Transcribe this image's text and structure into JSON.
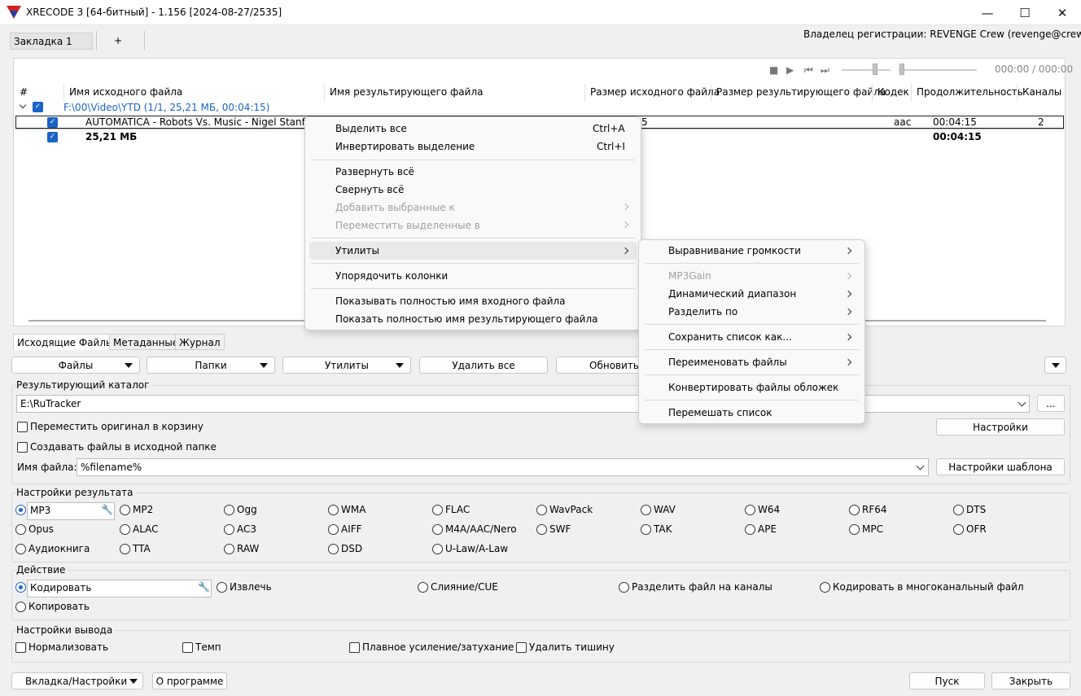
{
  "window": {
    "title": "XRECODE 3 [64-битный] - 1.156 [2024-08-27/2535]",
    "minimize": "—",
    "maximize": "☐",
    "close": "✕"
  },
  "tabs": {
    "active": "Закладка 1",
    "add": "+"
  },
  "owner": "Владелец регистрации: REVENGE Crew (revenge@crew.com)",
  "player": {
    "time": "000:00 / 000:00"
  },
  "columns": [
    "#",
    "Имя исходного файла",
    "Имя результирующего файла",
    "Размер исходного файла",
    "Размер результирующего файла",
    "Кодек",
    "Продолжительность",
    "Каналы"
  ],
  "list": {
    "group": "F:\\00\\Video\\YTD (1/1, 25,21 МБ, 00:04:15)",
    "file": {
      "name": "AUTOMATICA - Robots Vs. Music - Nigel Stanford.n",
      "size_tail": "5",
      "codec": "aac",
      "duration": "00:04:15",
      "channels": "2"
    },
    "total": {
      "size": "25,21 МБ",
      "duration": "00:04:15"
    }
  },
  "pane_tabs": [
    "Исходящие Файлы",
    "Метаданные",
    "Журнал"
  ],
  "toolbar": {
    "files": "Файлы",
    "folders": "Папки",
    "utilities": "Утилиты",
    "remove_all": "Удалить все",
    "refresh": "Обновить"
  },
  "output_dir": {
    "title": "Результирующий каталог",
    "value": "E:\\RuTracker",
    "browse": "...",
    "move_original": "Переместить оригинал в корзину",
    "create_in_source": "Создавать файлы в исходной папке",
    "settings": "Настройки",
    "filename_label": "Имя файла:",
    "filename_value": "%filename%",
    "template_settings": "Настройки шаблона"
  },
  "result_settings": {
    "title": "Настройки результата",
    "formats": [
      [
        "MP3",
        "MP2",
        "Ogg",
        "WMA",
        "FLAC",
        "WavPack",
        "WAV",
        "W64",
        "RF64",
        "DTS"
      ],
      [
        "Opus",
        "ALAC",
        "AC3",
        "AIFF",
        "M4A/AAC/Nero",
        "SWF",
        "TAK",
        "APE",
        "MPC",
        "OFR"
      ],
      [
        "Аудиокнига",
        "TTA",
        "RAW",
        "DSD",
        "U-Law/A-Law"
      ]
    ],
    "selected": "MP3"
  },
  "action": {
    "title": "Действие",
    "options": [
      "Кодировать",
      "Извлечь",
      "Слияние/CUE",
      "Разделить файл на каналы",
      "Кодировать в многоканальный файл",
      "Копировать"
    ]
  },
  "output_settings": {
    "title": "Настройки вывода",
    "normalize": "Нормализовать",
    "tempo": "Темп",
    "fade": "Плавное усиление/затухание",
    "silence": "Удалить тишину"
  },
  "footer": {
    "tab_settings": "Вкладка/Настройки",
    "about": "О программе",
    "start": "Пуск",
    "close": "Закрыть"
  },
  "context_menu": {
    "select_all": "Выделить все",
    "select_all_sc": "Ctrl+A",
    "invert": "Инвертировать выделение",
    "invert_sc": "Ctrl+I",
    "expand": "Развернуть всё",
    "collapse": "Свернуть всё",
    "add_selected": "Добавить выбранные к",
    "move_selected": "Переместить выделенные в",
    "utilities": "Утилиты",
    "arrange": "Упорядочить колонки",
    "show_input": "Показывать полностью имя входного файла",
    "show_output": "Показать полностью имя результирующего файла"
  },
  "submenu": {
    "loudness": "Выравнивание громкости",
    "mp3gain": "MP3Gain",
    "dynamic": "Динамический диапазон",
    "split": "Разделить по",
    "save_list": "Сохранить список как...",
    "rename": "Переименовать файлы",
    "convert_covers": "Конвертировать файлы обложек",
    "shuffle": "Перемешать список"
  }
}
